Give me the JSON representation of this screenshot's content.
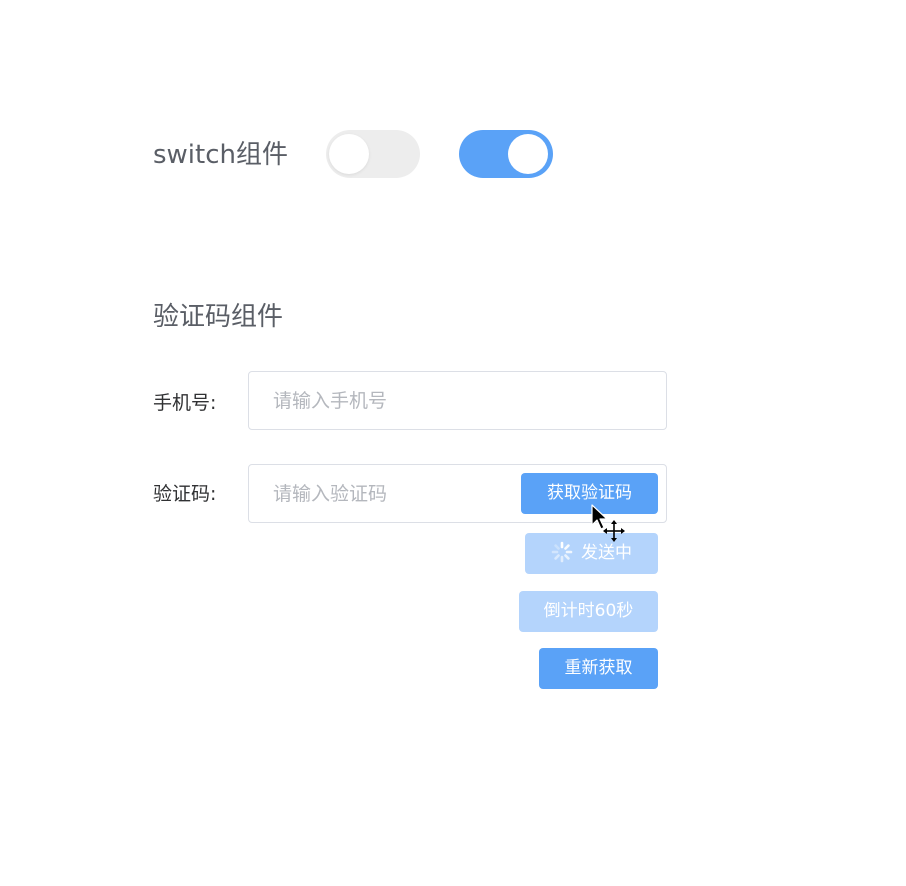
{
  "switch_section": {
    "title": "switch组件",
    "switches": [
      {
        "state": "off",
        "track_color": "#ededed"
      },
      {
        "state": "on",
        "track_color": "#5aa2f7"
      }
    ]
  },
  "captcha_section": {
    "title": "验证码组件",
    "phone": {
      "label": "手机号:",
      "value": "",
      "placeholder": "请输入手机号"
    },
    "code": {
      "label": "验证码:",
      "value": "",
      "placeholder": "请输入验证码"
    },
    "buttons": {
      "get_code": "获取验证码",
      "sending": "发送中",
      "countdown": "倒计时60秒",
      "resend": "重新获取"
    }
  },
  "icons": {
    "spinner": "loading-spinner-icon",
    "cursor": "move-cursor-icon"
  },
  "colors": {
    "primary": "#5aa2f7",
    "primary_disabled": "#b4d4fc",
    "switch_off": "#ededed",
    "text": "#5a5e66",
    "border": "#dcdfe6"
  }
}
